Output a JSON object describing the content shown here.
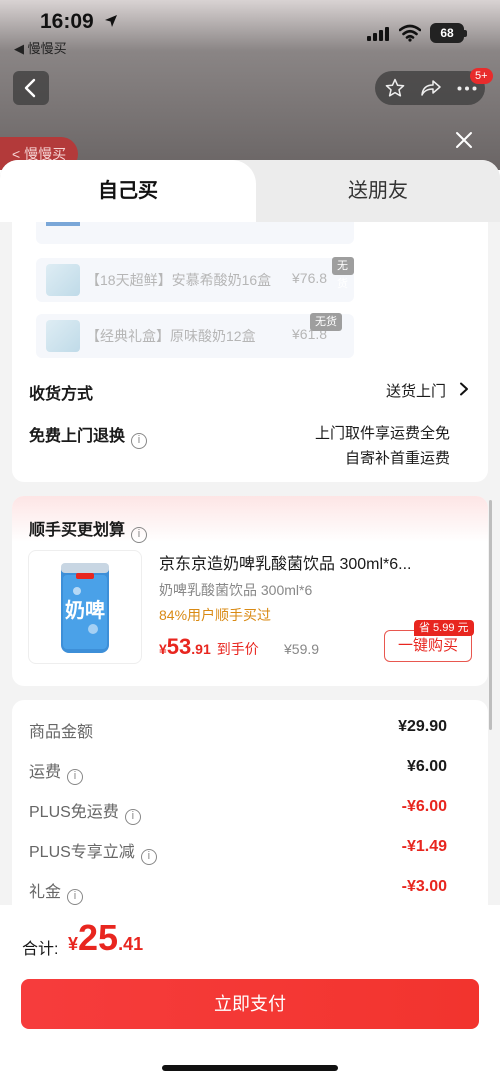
{
  "status_bar": {
    "time": "16:09",
    "back_app": "◀ 慢慢买",
    "battery": "68"
  },
  "background": {
    "badge": "5+",
    "tag": "< 慢慢买"
  },
  "tabs": {
    "self": "自己买",
    "friend": "送朋友"
  },
  "items": [
    {
      "name": "【18天超鲜】安慕希酸奶16盒",
      "price": "¥76.8",
      "status": "无货"
    },
    {
      "name": "【经典礼盒】原味酸奶12盒",
      "price": "¥61.8",
      "status": "无货"
    }
  ],
  "delivery": {
    "label": "收货方式",
    "value": "送货上门"
  },
  "return": {
    "label": "免费上门退换",
    "line1": "上门取件享运费全免",
    "line2": "自寄补首重运费"
  },
  "upsell": {
    "title": "顺手买更划算",
    "name": "京东京造奶啤乳酸菌饮品 300ml*6...",
    "spec": "奶啤乳酸菌饮品 300ml*6",
    "promo": "84%用户顺手买过",
    "price_currency": "¥",
    "price_int": "53",
    "price_dec": ".91",
    "price_tag": "到手价",
    "orig_price": "¥59.9",
    "save_badge": "省 5.99 元",
    "buy_label": "一键购买",
    "thumb_text": "奶啤"
  },
  "costs": [
    {
      "label": "商品金额",
      "value": "¥29.90",
      "info": false,
      "red": false
    },
    {
      "label": "运费",
      "value": "¥6.00",
      "info": true,
      "red": false
    },
    {
      "label": "PLUS免运费",
      "value": "-¥6.00",
      "info": true,
      "red": true
    },
    {
      "label": "PLUS专享立减",
      "value": "-¥1.49",
      "info": true,
      "red": true
    },
    {
      "label": "礼金",
      "value": "-¥3.00",
      "info": true,
      "red": true
    }
  ],
  "footer": {
    "total_label": "合计:",
    "total_currency": "¥",
    "total_int": "25",
    "total_dec": ".41",
    "pay_label": "立即支付"
  },
  "colors": {
    "accent": "#e8261f",
    "promo": "#d98a14"
  }
}
